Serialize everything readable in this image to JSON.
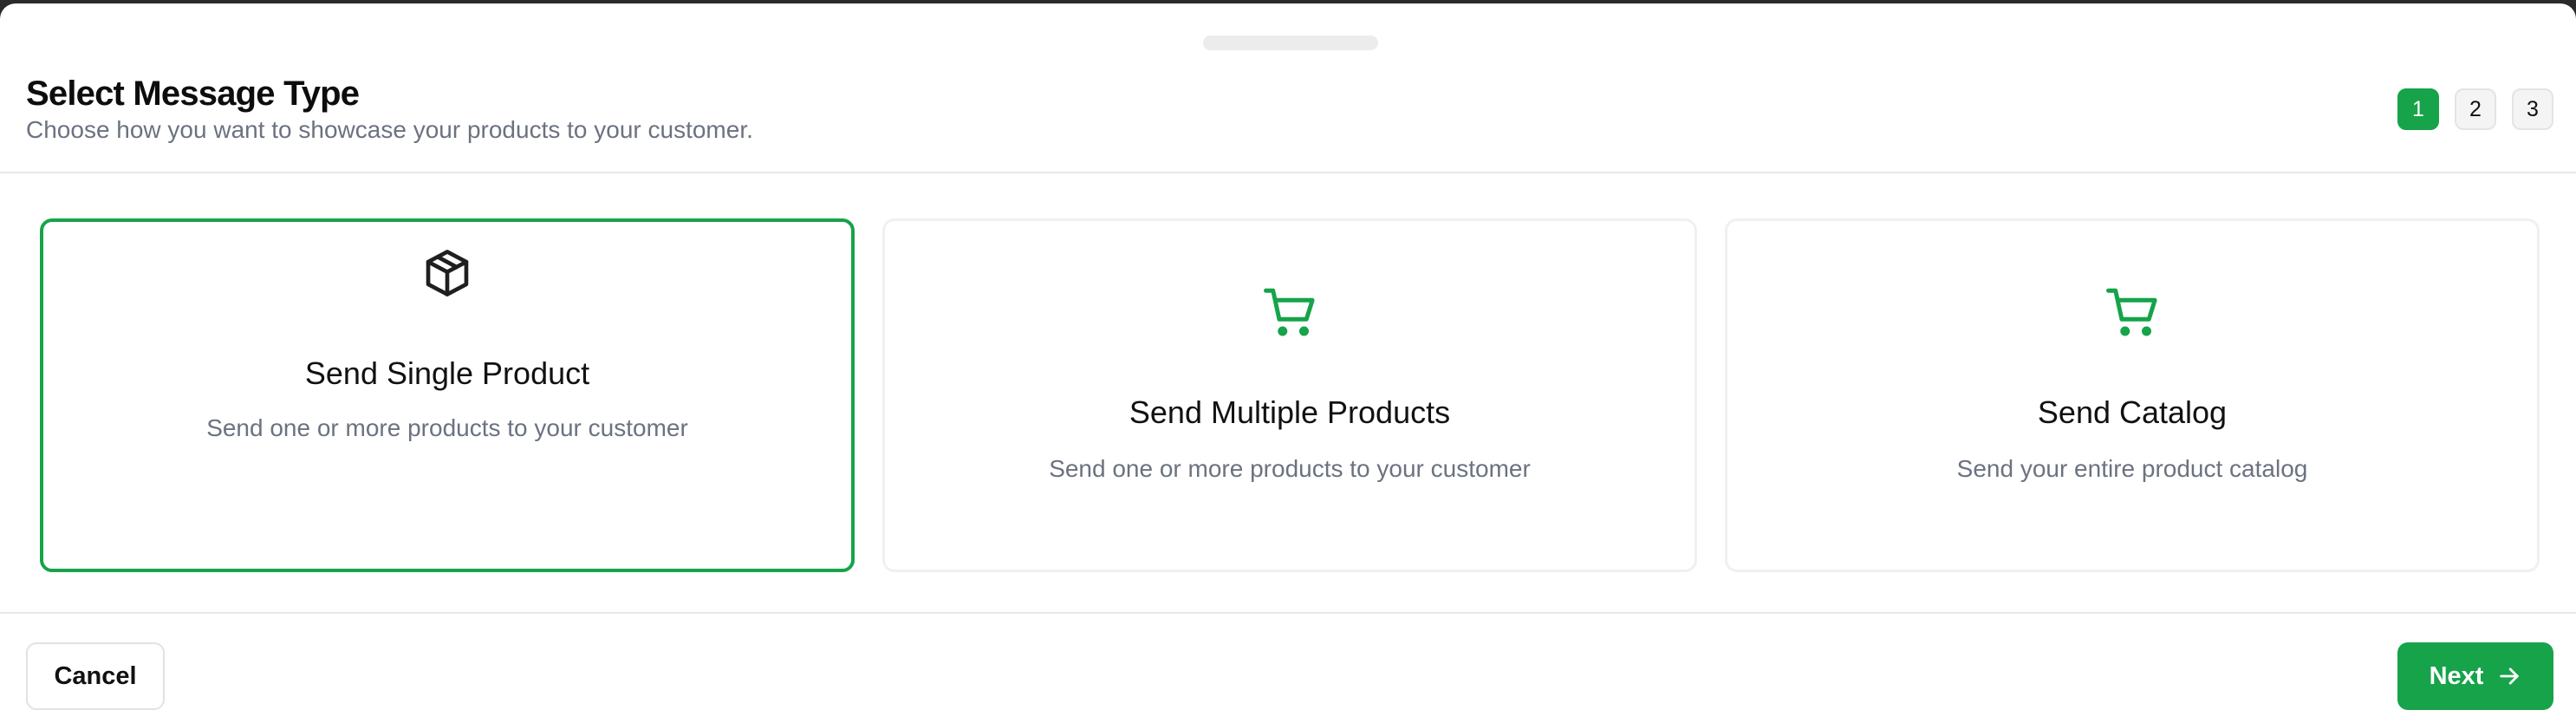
{
  "header": {
    "title": "Select Message Type",
    "subtitle": "Choose how you want to showcase your products to your customer.",
    "steps": [
      "1",
      "2",
      "3"
    ],
    "active_step": 1
  },
  "options": [
    {
      "icon": "package-icon",
      "title": "Send Single Product",
      "description": "Send one or more products to your customer",
      "selected": true
    },
    {
      "icon": "shopping-cart-icon",
      "title": "Send Multiple Products",
      "description": "Send one or more products to your customer",
      "selected": false
    },
    {
      "icon": "shopping-cart-icon",
      "title": "Send Catalog",
      "description": "Send your entire product catalog",
      "selected": false
    }
  ],
  "footer": {
    "cancel_label": "Cancel",
    "next_label": "Next",
    "next_icon": "arrow-right-icon"
  },
  "colors": {
    "accent": "#16a34a",
    "border": "#e8e8e8",
    "muted_text": "#6b7280"
  }
}
